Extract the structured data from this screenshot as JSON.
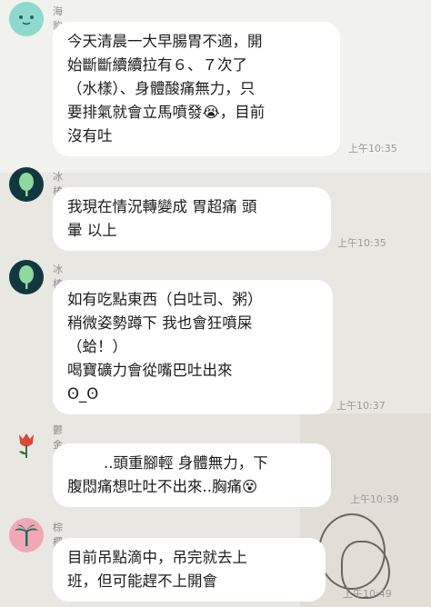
{
  "messages": [
    {
      "sender": "海豹",
      "avatar_icon": "teal-smiley-avatar",
      "lines": [
        "今天清晨一大早腸胃不適，開",
        "始斷斷續續拉有６、７次了",
        "（水樣）、身體酸痛無力，只",
        "要排氣就會立馬噴發😭，目前",
        "沒有吐"
      ],
      "time": "上午10:35"
    },
    {
      "sender": "冰棒",
      "avatar_icon": "tree-avatar",
      "lines": [
        "我現在情況轉變成 胃超痛 頭",
        "暈 以上"
      ],
      "time": "上午10:35"
    },
    {
      "sender": "冰棒",
      "avatar_icon": "tree-avatar",
      "lines": [
        "如有吃點東西（白吐司、粥）",
        "稍微姿勢蹲下 我也會狂噴屎",
        "（蛤！）",
        "喝寶礦力會從嘴巴吐出來",
        "ʘ_ʘ"
      ],
      "time": "上午10:37"
    },
    {
      "sender": "鬱金香",
      "avatar_icon": "tulip-avatar",
      "lines": [
        "..頭重腳輕 身體無力，下",
        "腹悶痛想吐吐不出來..胸痛😵"
      ],
      "time": "上午10:39"
    },
    {
      "sender": "棕櫚樹",
      "avatar_icon": "palm-tree-avatar",
      "lines": [
        "目前吊點滴中，吊完就去上",
        "班，但可能趕不上開會"
      ],
      "time": "上午10:49"
    }
  ],
  "colors": {
    "bubble": "#ffffff",
    "avatar_teal": "#8fd8cc",
    "avatar_dark": "#12383f",
    "tulip_red": "#d84a3a",
    "palm_pink": "#f2a7b4"
  }
}
